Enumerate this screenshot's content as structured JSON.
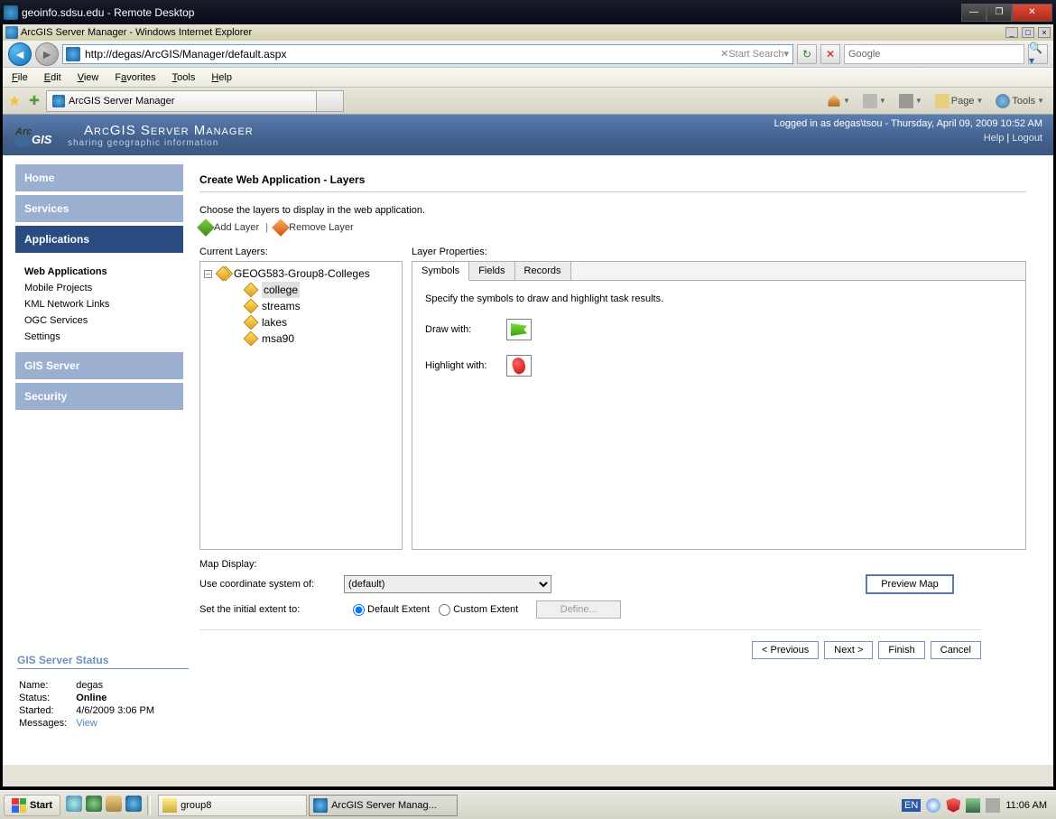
{
  "remote_desktop": {
    "title": "geoinfo.sdsu.edu - Remote Desktop"
  },
  "ie": {
    "title": "ArcGIS Server Manager - Windows Internet Explorer",
    "url": "http://degas/ArcGIS/Manager/default.aspx",
    "start_search": "Start Search",
    "search_provider": "Google",
    "menus": {
      "file": "File",
      "edit": "Edit",
      "view": "View",
      "favorites": "Favorites",
      "tools": "Tools",
      "help": "Help"
    },
    "tab_title": "ArcGIS Server Manager",
    "toolbar": {
      "page": "Page",
      "tools": "Tools"
    }
  },
  "arcgis": {
    "product": "ArcGIS Server Manager",
    "tagline": "sharing geographic information",
    "login_info": "Logged in as degas\\tsou - Thursday, April 09, 2009 10:52 AM",
    "links": {
      "help": "Help",
      "logout": "Logout"
    },
    "sidebar": {
      "home": "Home",
      "services": "Services",
      "applications": "Applications",
      "subs": {
        "web": "Web Applications",
        "mobile": "Mobile Projects",
        "kml": "KML Network Links",
        "ogc": "OGC Services",
        "settings": "Settings"
      },
      "gis": "GIS Server",
      "security": "Security"
    },
    "status": {
      "heading": "GIS Server Status",
      "name_lbl": "Name:",
      "name": "degas",
      "status_lbl": "Status:",
      "status": "Online",
      "started_lbl": "Started:",
      "started": "4/6/2009 3:06 PM",
      "messages_lbl": "Messages:",
      "messages": "View"
    },
    "page": {
      "title": "Create Web Application - Layers",
      "instr": "Choose the layers to display in the web application.",
      "add_layer": "Add Layer",
      "remove_layer": "Remove Layer",
      "current_layers_lbl": "Current Layers:",
      "root_layer": "GEOG583-Group8-Colleges",
      "layers": [
        "college",
        "streams",
        "lakes",
        "msa90"
      ],
      "selected_layer": "college",
      "layer_props_lbl": "Layer Properties:",
      "tabs": {
        "symbols": "Symbols",
        "fields": "Fields",
        "records": "Records"
      },
      "symbol_instr": "Specify the symbols to draw and highlight task results.",
      "draw_lbl": "Draw with:",
      "highlight_lbl": "Highlight with:",
      "map_display_lbl": "Map Display:",
      "coord_lbl": "Use coordinate system of:",
      "coord_val": "(default)",
      "extent_lbl": "Set the initial extent to:",
      "extent_default": "Default Extent",
      "extent_custom": "Custom Extent",
      "define": "Define...",
      "preview": "Preview Map",
      "prev": "< Previous",
      "next": "Next >",
      "finish": "Finish",
      "cancel": "Cancel"
    }
  },
  "taskbar": {
    "start": "Start",
    "tasks": [
      {
        "label": "group8",
        "icon": "folder"
      },
      {
        "label": "ArcGIS Server Manag...",
        "icon": "ie",
        "active": true
      }
    ],
    "clock": "11:06 AM",
    "lang": "EN"
  }
}
